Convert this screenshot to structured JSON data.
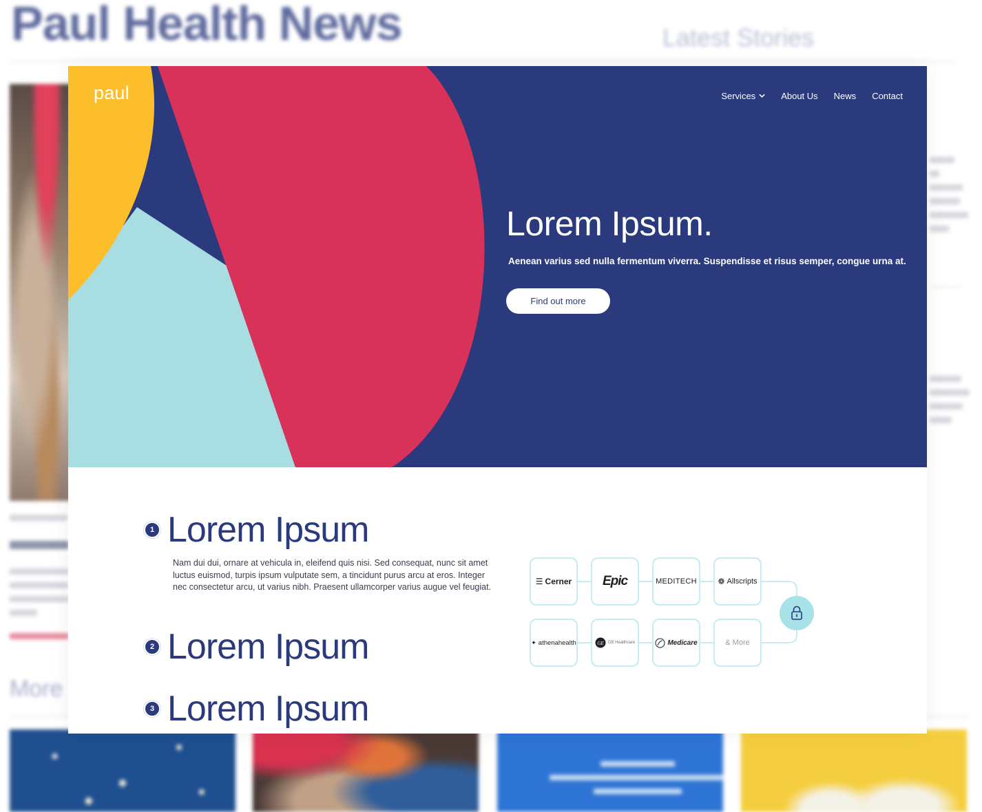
{
  "background": {
    "title": "Paul Health News",
    "latest_heading": "Latest Stories",
    "more_heading": "More"
  },
  "header": {
    "logo": "paul",
    "nav": [
      {
        "label": "Services",
        "has_dropdown": true
      },
      {
        "label": "About Us"
      },
      {
        "label": "News"
      },
      {
        "label": "Contact"
      }
    ]
  },
  "hero": {
    "title": "Lorem Ipsum.",
    "subtitle": "Aenean varius sed nulla fermentum viverra. Suspendisse et risus semper, congue urna at.",
    "cta_label": "Find out more",
    "colors": {
      "navy": "#2a3a7c",
      "red": "#d8325a",
      "yellow": "#fcbf2b",
      "teal": "#a8dde2"
    }
  },
  "steps": [
    {
      "number": "1",
      "title": "Lorem Ipsum",
      "body": "Nam dui dui, ornare at vehicula in, eleifend quis nisi. Sed consequat, nunc sit amet luctus euismod, turpis ipsum vulputate sem, a tincidunt purus arcu at eros. Integer nec consectetur arcu, ut varius nibh. Praesent ullamcorper varius augue vel feugiat."
    },
    {
      "number": "2",
      "title": "Lorem Ipsum"
    },
    {
      "number": "3",
      "title": "Lorem Ipsum"
    }
  ],
  "integrations": {
    "row1": [
      "Cerner",
      "Epic",
      "MEDITECH",
      "Allscripts"
    ],
    "row2": [
      "athenahealth",
      "GE Healthcare",
      "Medicare",
      "& More"
    ],
    "lock_icon": "lock-icon"
  }
}
